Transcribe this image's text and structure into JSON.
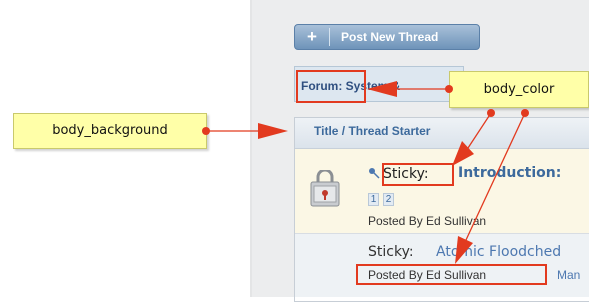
{
  "toolbar": {
    "post_new_thread_label": "Post New Thread",
    "plus_glyph": "+"
  },
  "breadcrumb": {
    "label": "Forum: System &"
  },
  "thread_list": {
    "header": "Title / Thread Starter",
    "rows": [
      {
        "prefix": "Sticky:",
        "title": "Introduction:",
        "pages": [
          "1",
          "2"
        ],
        "posted_by": "Posted By Ed Sullivan",
        "icon": "thread-icon",
        "pin_icon": "pin-icon"
      },
      {
        "prefix": "Sticky:",
        "title": "Atomic Floodched",
        "posted_by": "Posted By Ed Sullivan",
        "extra": "Man"
      }
    ]
  },
  "callouts": {
    "body_background": "body_background",
    "body_color": "body_color"
  },
  "colors": {
    "highlight_red": "#e23a1f",
    "callout_yellow": "#ffffa8",
    "link_blue": "#3d6a9c",
    "sticky_row_bg": "#fbf7e5"
  }
}
